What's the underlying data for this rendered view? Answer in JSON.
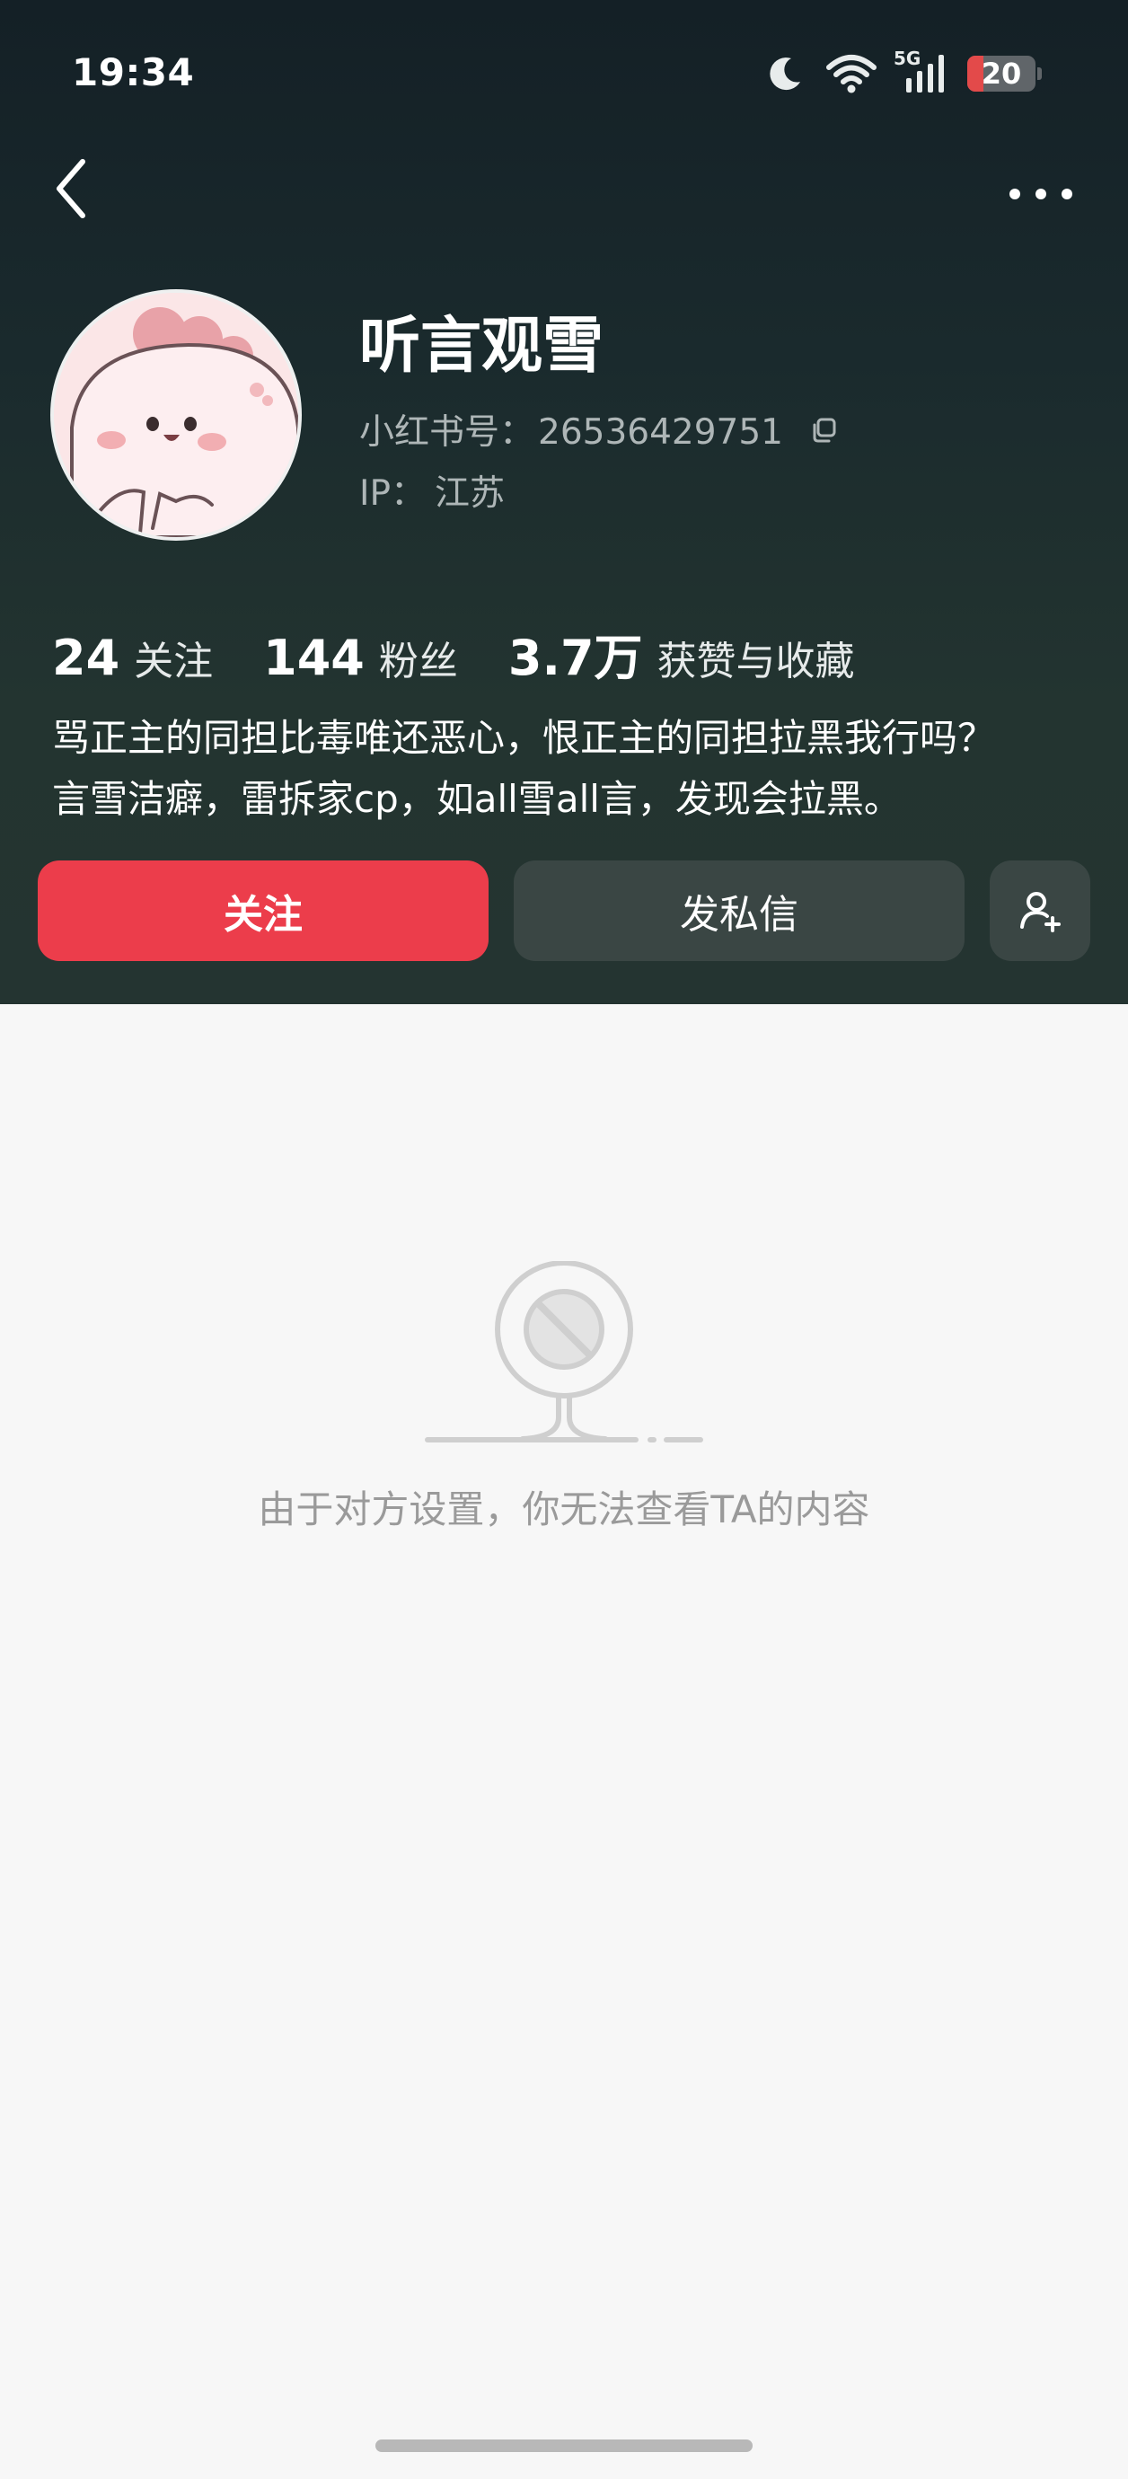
{
  "status_bar": {
    "time": "19:34",
    "network": "5G",
    "battery": "20"
  },
  "profile": {
    "name": "听言观雪",
    "xhs_id_label": "小红书号：",
    "xhs_id": "26536429751",
    "ip_label": "IP：",
    "ip_location": "江苏"
  },
  "stats": [
    {
      "value": "24",
      "label": "关注"
    },
    {
      "value": "144",
      "label": "粉丝"
    },
    {
      "value": "3.7万",
      "label": "获赞与收藏"
    }
  ],
  "bio": {
    "line1": "骂正主的同担比毒唯还恶心，恨正主的同担拉黑我行吗？",
    "line2": "言雪洁癖，雷拆家cp，如all雪all言，发现会拉黑。"
  },
  "actions": {
    "follow_label": "关注",
    "message_label": "发私信"
  },
  "empty_state": {
    "text": "由于对方设置，你无法查看TA的内容"
  },
  "icons": {
    "back": "back-arrow-icon",
    "more": "more-dots-icon",
    "copy": "copy-icon",
    "add_friend": "add-person-icon",
    "moon": "moon-icon",
    "wifi": "wifi-icon",
    "signal": "signal-icon",
    "blocked": "blocked-icon"
  },
  "colors": {
    "header_bg": "#1b2a2d",
    "follow_button": "#ec3d4b",
    "secondary_button": "#3a4644",
    "page_bg": "#f7f7f7"
  }
}
